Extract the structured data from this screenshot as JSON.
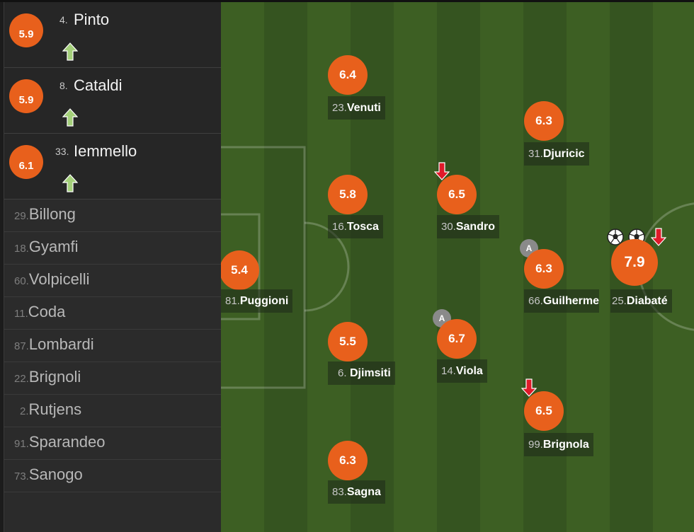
{
  "colors": {
    "rating": "#e8601c",
    "pitch_light": "#3d5f23",
    "pitch_dark": "#355420",
    "sidebar": "#2b2b2b",
    "arrow_up": "#a4d07a",
    "arrow_down": "#e01a2a"
  },
  "substitutes": [
    {
      "rating": "5.9",
      "number": "4.",
      "name": "Pinto",
      "icon": "sub-in-arrow-icon"
    },
    {
      "rating": "5.9",
      "number": "8.",
      "name": "Cataldi",
      "icon": "sub-in-arrow-icon"
    },
    {
      "rating": "6.1",
      "number": "33.",
      "name": "Iemmello",
      "icon": "sub-in-arrow-icon"
    }
  ],
  "bench": [
    {
      "number": "29.",
      "name": "Billong"
    },
    {
      "number": "18.",
      "name": "Gyamfi"
    },
    {
      "number": "60.",
      "name": "Volpicelli"
    },
    {
      "number": "11.",
      "name": "Coda"
    },
    {
      "number": "87.",
      "name": "Lombardi"
    },
    {
      "number": "22.",
      "name": "Brignoli"
    },
    {
      "number": "2.",
      "name": "Rutjens"
    },
    {
      "number": "91.",
      "name": "Sparandeo"
    },
    {
      "number": "73.",
      "name": "Sanogo"
    }
  ],
  "players": {
    "venuti": {
      "rating": "6.4",
      "number": "23.",
      "name": "Venuti"
    },
    "djuricic": {
      "rating": "6.3",
      "number": "31.",
      "name": "Djuricic"
    },
    "tosca": {
      "rating": "5.8",
      "number": "16.",
      "name": "Tosca"
    },
    "sandro": {
      "rating": "6.5",
      "number": "30.",
      "name": "Sandro",
      "icon": "sub-out-arrow-icon"
    },
    "puggioni": {
      "rating": "5.4",
      "number": "81.",
      "name": "Puggioni"
    },
    "guilherme": {
      "rating": "6.3",
      "number": "66.",
      "name": "Guilherme",
      "badge": "A"
    },
    "diabate": {
      "rating": "7.9",
      "number": "25.",
      "name": "Diabaté",
      "icons": [
        "goal-ball-icon",
        "goal-ball-icon",
        "sub-out-arrow-icon"
      ]
    },
    "djimsiti": {
      "rating": "5.5",
      "number": "6.",
      "name": "Djimsiti"
    },
    "viola": {
      "rating": "6.7",
      "number": "14.",
      "name": "Viola",
      "badge": "A"
    },
    "brignola": {
      "rating": "6.5",
      "number": "99.",
      "name": "Brignola",
      "icon": "sub-out-arrow-icon"
    },
    "sagna": {
      "rating": "6.3",
      "number": "83.",
      "name": "Sagna"
    }
  }
}
